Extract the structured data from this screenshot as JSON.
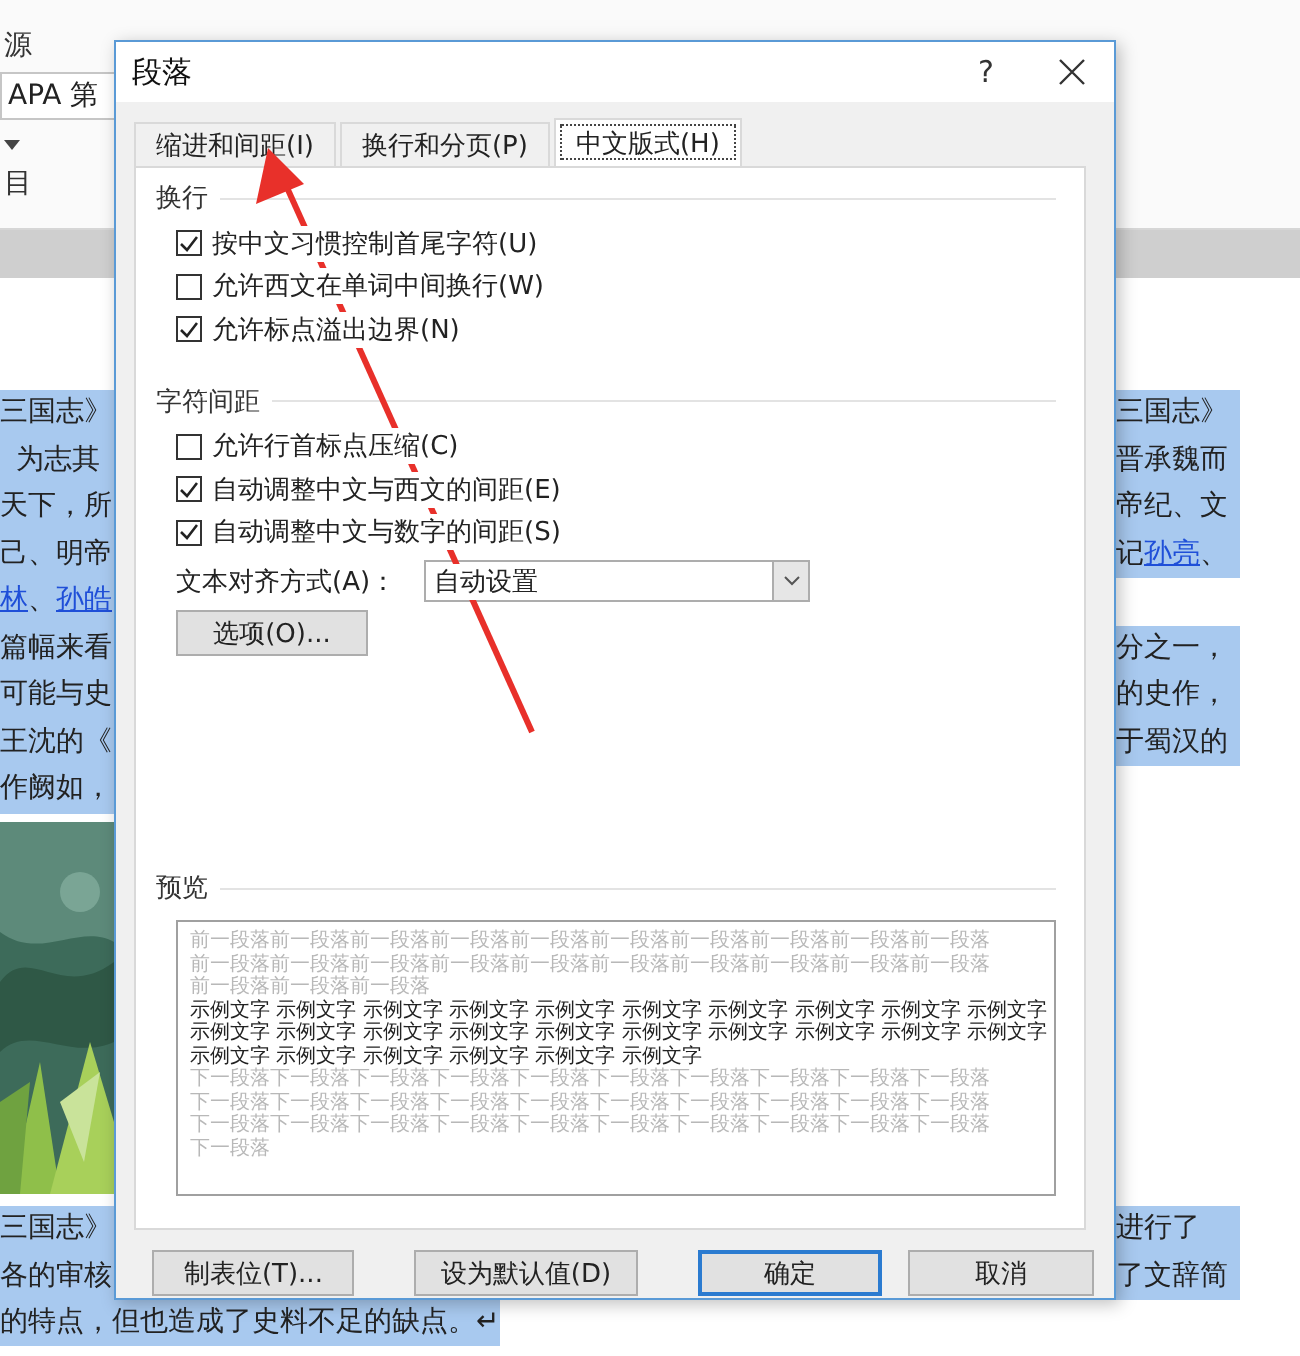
{
  "ribbon": {
    "label_top": "源",
    "style_box": "APA 第",
    "group_label": "目"
  },
  "document": {
    "left_lines": [
      {
        "segments": [
          {
            "text": "三国志》",
            "link": false
          }
        ],
        "indent": false
      },
      {
        "segments": [
          {
            "text": "为志其",
            "link": false
          }
        ],
        "indent": true
      },
      {
        "segments": [
          {
            "text": "天下，所",
            "link": false
          }
        ],
        "indent": false
      },
      {
        "segments": [
          {
            "text": "己、明帝",
            "link": false
          }
        ],
        "indent": false
      },
      {
        "segments": [
          {
            "text": "林",
            "link": true
          },
          {
            "text": "、",
            "link": false
          },
          {
            "text": "孙皓",
            "link": true
          }
        ],
        "indent": false
      },
      {
        "segments": [
          {
            "text": "篇幅来看",
            "link": false
          }
        ],
        "indent": false
      },
      {
        "segments": [
          {
            "text": "可能与史",
            "link": false
          }
        ],
        "indent": false
      },
      {
        "segments": [
          {
            "text": "王沈的《",
            "link": false
          }
        ],
        "indent": false
      },
      {
        "segments": [
          {
            "text": "作阙如，",
            "link": false
          }
        ],
        "indent": false
      }
    ],
    "left_bottom_lines": [
      "三国志》",
      "各的审核"
    ],
    "right_lines": [
      {
        "segments": [
          {
            "text": "三国志》",
            "link": false
          }
        ]
      },
      {
        "segments": [
          {
            "text": "晋承魏而",
            "link": false
          }
        ]
      },
      {
        "segments": [
          {
            "text": "帝纪、文",
            "link": false
          }
        ]
      },
      {
        "segments": [
          {
            "text": "记",
            "link": false
          },
          {
            "text": "孙亮",
            "link": true
          },
          {
            "text": "、",
            "link": false
          }
        ]
      }
    ],
    "right_middle_lines": [
      {
        "segments": [
          {
            "text": "分之一，",
            "link": false
          }
        ]
      },
      {
        "segments": [
          {
            "text": "的史作，",
            "link": false
          }
        ]
      },
      {
        "segments": [
          {
            "text": "于蜀汉的",
            "link": false
          }
        ]
      }
    ],
    "right_bottom_lines": [
      "进行了",
      "了文辞简"
    ],
    "last_line": "的特点，但也造成了史料不足的缺点。↵"
  },
  "dialog": {
    "title": "段落",
    "help": "?",
    "tabs": [
      {
        "label": "缩进和间距(I)",
        "selected": false
      },
      {
        "label": "换行和分页(P)",
        "selected": false
      },
      {
        "label": "中文版式(H)",
        "selected": true
      }
    ],
    "sections": [
      {
        "title": "换行",
        "options": [
          {
            "label": "按中文习惯控制首尾字符(U)",
            "checked": true
          },
          {
            "label": "允许西文在单词中间换行(W)",
            "checked": false
          },
          {
            "label": "允许标点溢出边界(N)",
            "checked": true
          }
        ]
      },
      {
        "title": "字符间距",
        "options": [
          {
            "label": "允许行首标点压缩(C)",
            "checked": false
          },
          {
            "label": "自动调整中文与西文的间距(E)",
            "checked": true
          },
          {
            "label": "自动调整中文与数字的间距(S)",
            "checked": true
          }
        ]
      }
    ],
    "alignment": {
      "label": "文本对齐方式(A)：",
      "value": "自动设置"
    },
    "options_button": "选项(O)...",
    "preview": {
      "title": "预览",
      "lines": [
        {
          "kind": "context",
          "text": "前一段落前一段落前一段落前一段落前一段落前一段落前一段落前一段落前一段落前一段落"
        },
        {
          "kind": "context",
          "text": "前一段落前一段落前一段落前一段落前一段落前一段落前一段落前一段落前一段落前一段落"
        },
        {
          "kind": "context",
          "text": "前一段落前一段落前一段落"
        },
        {
          "kind": "sample",
          "text": "示例文字 示例文字 示例文字 示例文字 示例文字 示例文字 示例文字 示例文字 示例文字 示例文字"
        },
        {
          "kind": "sample",
          "text": "示例文字 示例文字 示例文字 示例文字 示例文字 示例文字 示例文字 示例文字 示例文字 示例文字"
        },
        {
          "kind": "sample",
          "text": "示例文字 示例文字 示例文字 示例文字 示例文字 示例文字"
        },
        {
          "kind": "context",
          "text": "下一段落下一段落下一段落下一段落下一段落下一段落下一段落下一段落下一段落下一段落"
        },
        {
          "kind": "context",
          "text": "下一段落下一段落下一段落下一段落下一段落下一段落下一段落下一段落下一段落下一段落"
        },
        {
          "kind": "context",
          "text": "下一段落下一段落下一段落下一段落下一段落下一段落下一段落下一段落下一段落下一段落"
        },
        {
          "kind": "context",
          "text": "下一段落"
        }
      ]
    },
    "buttons": [
      {
        "label": "制表位(T)...",
        "default": false
      },
      {
        "label": "设为默认值(D)",
        "default": false
      },
      {
        "label": "确定",
        "default": true
      },
      {
        "label": "取消",
        "default": false
      }
    ]
  }
}
